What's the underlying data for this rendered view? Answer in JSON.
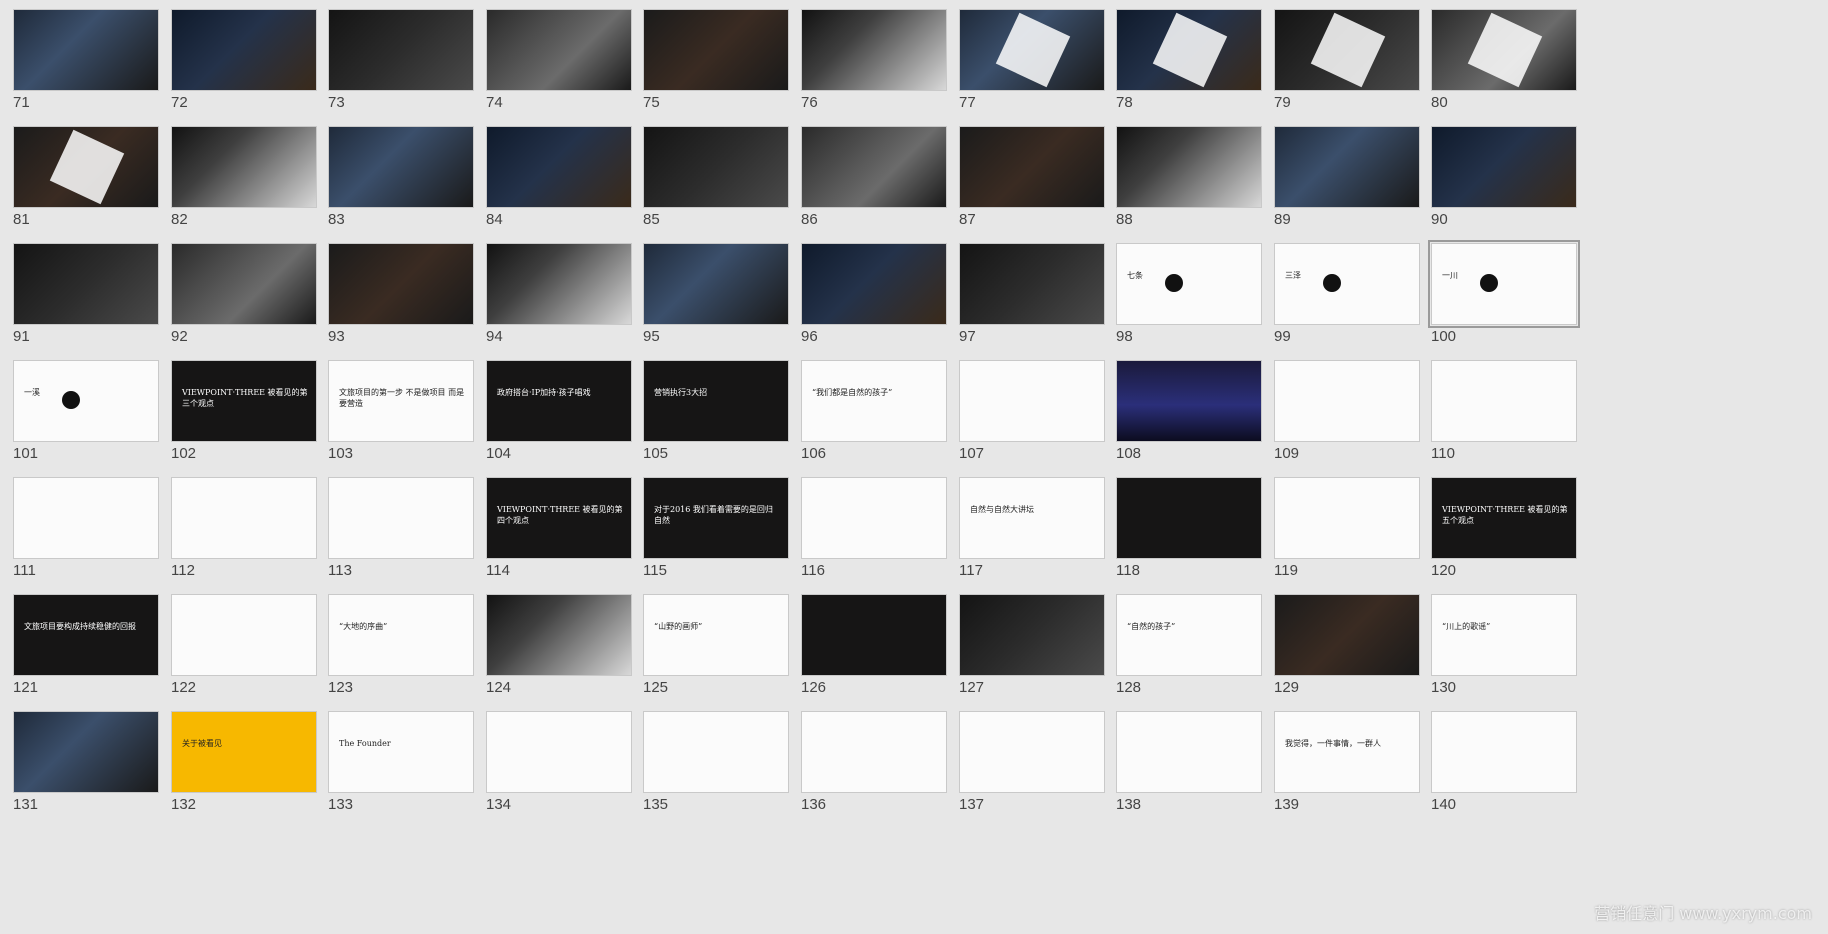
{
  "watermark": "营销任意门 www.yxrym.com",
  "colors": {
    "background": "#e7e7e7",
    "number": "#444444"
  },
  "slides": [
    {
      "n": 71,
      "theme": "photo"
    },
    {
      "n": 72,
      "theme": "photo"
    },
    {
      "n": 73,
      "theme": "photo"
    },
    {
      "n": 74,
      "theme": "photo"
    },
    {
      "n": 75,
      "theme": "photo"
    },
    {
      "n": 76,
      "theme": "photo"
    },
    {
      "n": 77,
      "theme": "photo"
    },
    {
      "n": 78,
      "theme": "photo"
    },
    {
      "n": 79,
      "theme": "photo"
    },
    {
      "n": 80,
      "theme": "photo"
    },
    {
      "n": 81,
      "theme": "photo"
    },
    {
      "n": 82,
      "theme": "photo"
    },
    {
      "n": 83,
      "theme": "photo"
    },
    {
      "n": 84,
      "theme": "photo"
    },
    {
      "n": 85,
      "theme": "photo"
    },
    {
      "n": 86,
      "theme": "photo"
    },
    {
      "n": 87,
      "theme": "photo"
    },
    {
      "n": 88,
      "theme": "photo"
    },
    {
      "n": 89,
      "theme": "photo"
    },
    {
      "n": 90,
      "theme": "photo"
    },
    {
      "n": 91,
      "theme": "photo"
    },
    {
      "n": 92,
      "theme": "photo"
    },
    {
      "n": 93,
      "theme": "photo"
    },
    {
      "n": 94,
      "theme": "photo"
    },
    {
      "n": 95,
      "theme": "photo"
    },
    {
      "n": 96,
      "theme": "photo"
    },
    {
      "n": 97,
      "theme": "photo"
    },
    {
      "n": 98,
      "theme": "light",
      "text": "七条"
    },
    {
      "n": 99,
      "theme": "light",
      "text": "三泽"
    },
    {
      "n": 100,
      "theme": "light",
      "text": "一川",
      "selected": true
    },
    {
      "n": 101,
      "theme": "light",
      "text": "一溪"
    },
    {
      "n": 102,
      "theme": "dark",
      "text": "VIEWPOINT·THREE 被看见的第三个观点"
    },
    {
      "n": 103,
      "theme": "light",
      "text": "文旅项目的第一步 不是做项目 而是要营造"
    },
    {
      "n": 104,
      "theme": "dark",
      "text": "政府搭台·IP加持·孩子唱戏"
    },
    {
      "n": 105,
      "theme": "dark",
      "text": "营销执行3大招"
    },
    {
      "n": 106,
      "theme": "light",
      "text": "“我们都是自然的孩子”"
    },
    {
      "n": 107,
      "theme": "light"
    },
    {
      "n": 108,
      "theme": "stage"
    },
    {
      "n": 109,
      "theme": "light"
    },
    {
      "n": 110,
      "theme": "light"
    },
    {
      "n": 111,
      "theme": "light"
    },
    {
      "n": 112,
      "theme": "light"
    },
    {
      "n": 113,
      "theme": "light"
    },
    {
      "n": 114,
      "theme": "dark",
      "text": "VIEWPOINT·THREE 被看见的第四个观点"
    },
    {
      "n": 115,
      "theme": "dark",
      "text": "对于2016 我们看着需要的是回归自然"
    },
    {
      "n": 116,
      "theme": "light"
    },
    {
      "n": 117,
      "theme": "light",
      "text": "自然与自然大讲坛"
    },
    {
      "n": 118,
      "theme": "dark"
    },
    {
      "n": 119,
      "theme": "light"
    },
    {
      "n": 120,
      "theme": "dark",
      "text": "VIEWPOINT·THREE 被看见的第五个观点"
    },
    {
      "n": 121,
      "theme": "dark",
      "text": "文旅项目要构成持续稳健的回报"
    },
    {
      "n": 122,
      "theme": "light"
    },
    {
      "n": 123,
      "theme": "light",
      "text": "“大地的序曲”"
    },
    {
      "n": 124,
      "theme": "photo"
    },
    {
      "n": 125,
      "theme": "light",
      "text": "“山野的画师”"
    },
    {
      "n": 126,
      "theme": "dark"
    },
    {
      "n": 127,
      "theme": "photo"
    },
    {
      "n": 128,
      "theme": "light",
      "text": "“自然的孩子”"
    },
    {
      "n": 129,
      "theme": "photo"
    },
    {
      "n": 130,
      "theme": "light",
      "text": "“川上的歌谣”"
    },
    {
      "n": 131,
      "theme": "photo"
    },
    {
      "n": 132,
      "theme": "yellow",
      "text": "关于被看见"
    },
    {
      "n": 133,
      "theme": "light",
      "text": "The Founder"
    },
    {
      "n": 134,
      "theme": "light"
    },
    {
      "n": 135,
      "theme": "light"
    },
    {
      "n": 136,
      "theme": "light"
    },
    {
      "n": 137,
      "theme": "light"
    },
    {
      "n": 138,
      "theme": "light"
    },
    {
      "n": 139,
      "theme": "light",
      "text": "我觉得，一件事情，一群人"
    },
    {
      "n": 140,
      "theme": "light"
    }
  ]
}
